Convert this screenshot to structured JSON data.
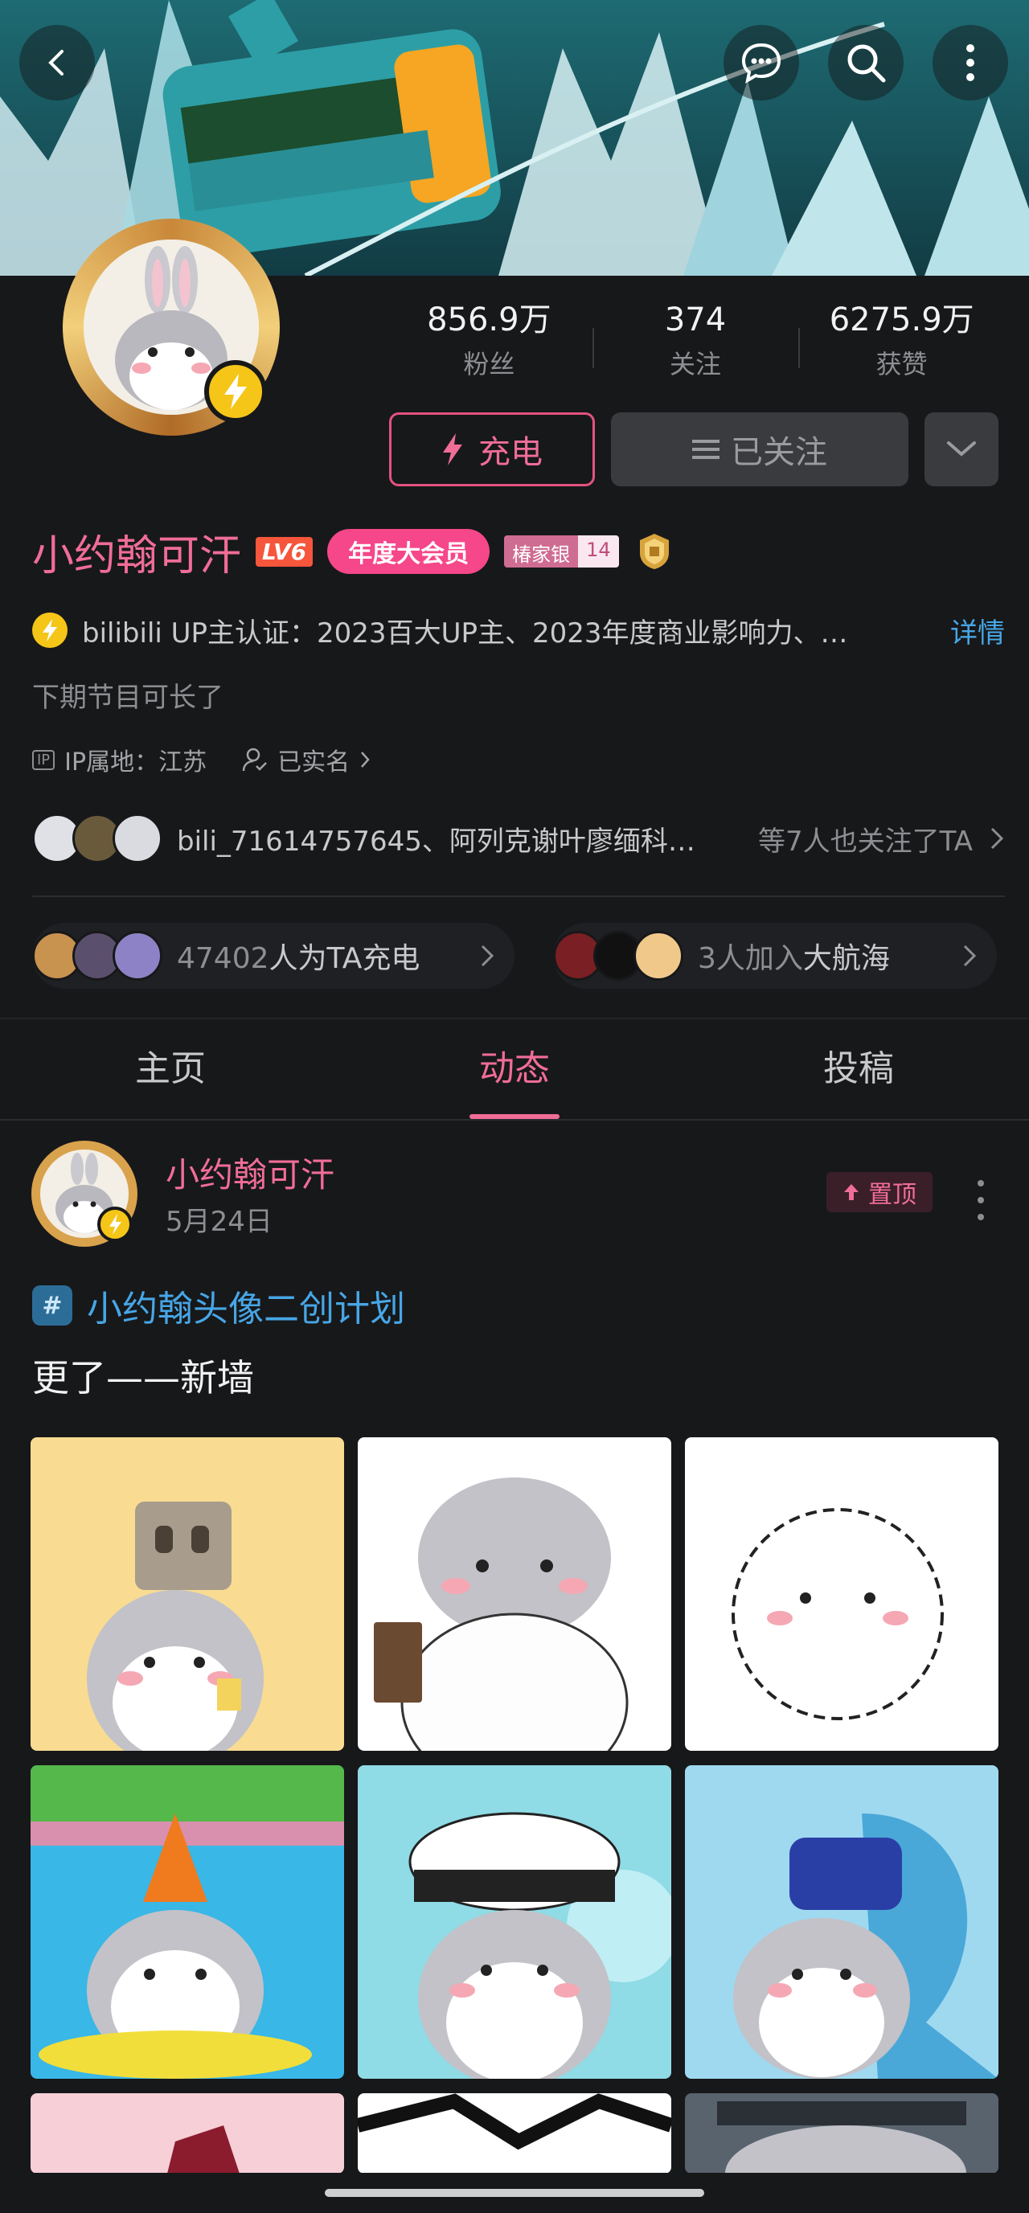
{
  "header": {
    "back_icon": "chevron-left-icon",
    "message_icon": "chat-bubble-icon",
    "search_icon": "search-icon",
    "more_icon": "vertical-dots-icon"
  },
  "profile": {
    "stats": [
      {
        "value": "856.9万",
        "label": "粉丝"
      },
      {
        "value": "374",
        "label": "关注"
      },
      {
        "value": "6275.9万",
        "label": "获赞"
      }
    ],
    "charge_label": "充电",
    "following_label": "已关注",
    "username": "小约翰可汗",
    "level_badge": "LV6",
    "vip_badge": "年度大会员",
    "medal_name": "椿家银",
    "medal_level": "14",
    "certification": "bilibili UP主认证：2023百大UP主、2023年度商业影响力、…",
    "certification_detail": "详情",
    "bio": "下期节目可长了",
    "ip_tag": "IP",
    "ip_location": "IP属地：江苏",
    "real_name": "已实名",
    "mutual_follow_names": "bili_71614757645、阿列克谢叶廖缅科…",
    "mutual_follow_suffix": "等7人也关注了TA",
    "charge_count": "47402",
    "charge_text": "人为TA充电",
    "fleet_count": "3人加入",
    "fleet_text": "大航海"
  },
  "tabs": [
    {
      "label": "主页",
      "active": false
    },
    {
      "label": "动态",
      "active": true
    },
    {
      "label": "投稿",
      "active": false
    }
  ],
  "post": {
    "author": "小约翰可汗",
    "date": "5月24日",
    "pin_label": "置顶",
    "topic_icon_symbol": "#",
    "topic": "小约翰头像二创计划",
    "text": "更了——新墙"
  },
  "colors": {
    "accent_pink": "#f06d97",
    "link_blue": "#47a6e6",
    "background": "#17181a"
  }
}
